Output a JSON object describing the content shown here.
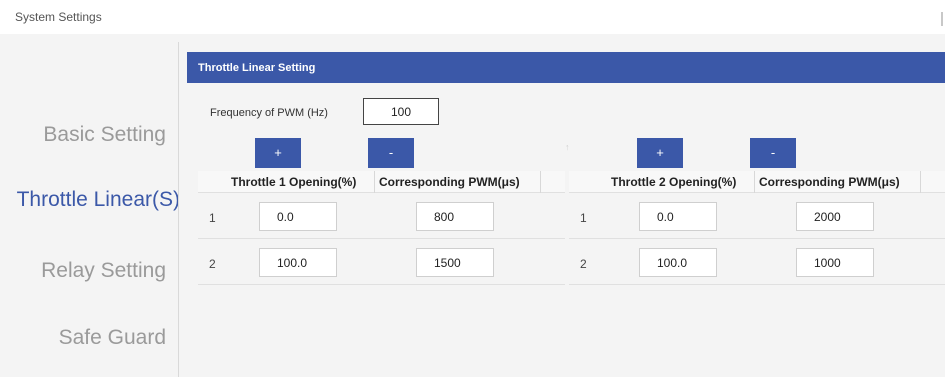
{
  "app": {
    "title": "System Settings"
  },
  "sidebar": {
    "items": [
      {
        "label": "Basic Setting",
        "active": false
      },
      {
        "label": "Throttle Linear(S)",
        "active": true
      },
      {
        "label": "Relay Setting",
        "active": false
      },
      {
        "label": "Safe Guard",
        "active": false
      }
    ]
  },
  "panel": {
    "title": "Throttle Linear Setting",
    "frequency": {
      "label": "Frequency of PWM (Hz)",
      "value": "100"
    },
    "scroll_indicator": "↑",
    "tables": [
      {
        "add_label": "+",
        "remove_label": "-",
        "columns": [
          "Throttle 1 Opening(%)",
          "Corresponding PWM(μs)"
        ],
        "rows": [
          {
            "index": "1",
            "opening": "0.0",
            "pwm": "800"
          },
          {
            "index": "2",
            "opening": "100.0",
            "pwm": "1500"
          }
        ]
      },
      {
        "add_label": "+",
        "remove_label": "-",
        "columns": [
          "Throttle 2 Opening(%)",
          "Corresponding PWM(μs)"
        ],
        "rows": [
          {
            "index": "1",
            "opening": "0.0",
            "pwm": "2000"
          },
          {
            "index": "2",
            "opening": "100.0",
            "pwm": "1000"
          }
        ]
      }
    ]
  },
  "colors": {
    "accent": "#3b58a8",
    "inactive_nav": "#9a9a9a",
    "background": "#f4f4f4"
  }
}
